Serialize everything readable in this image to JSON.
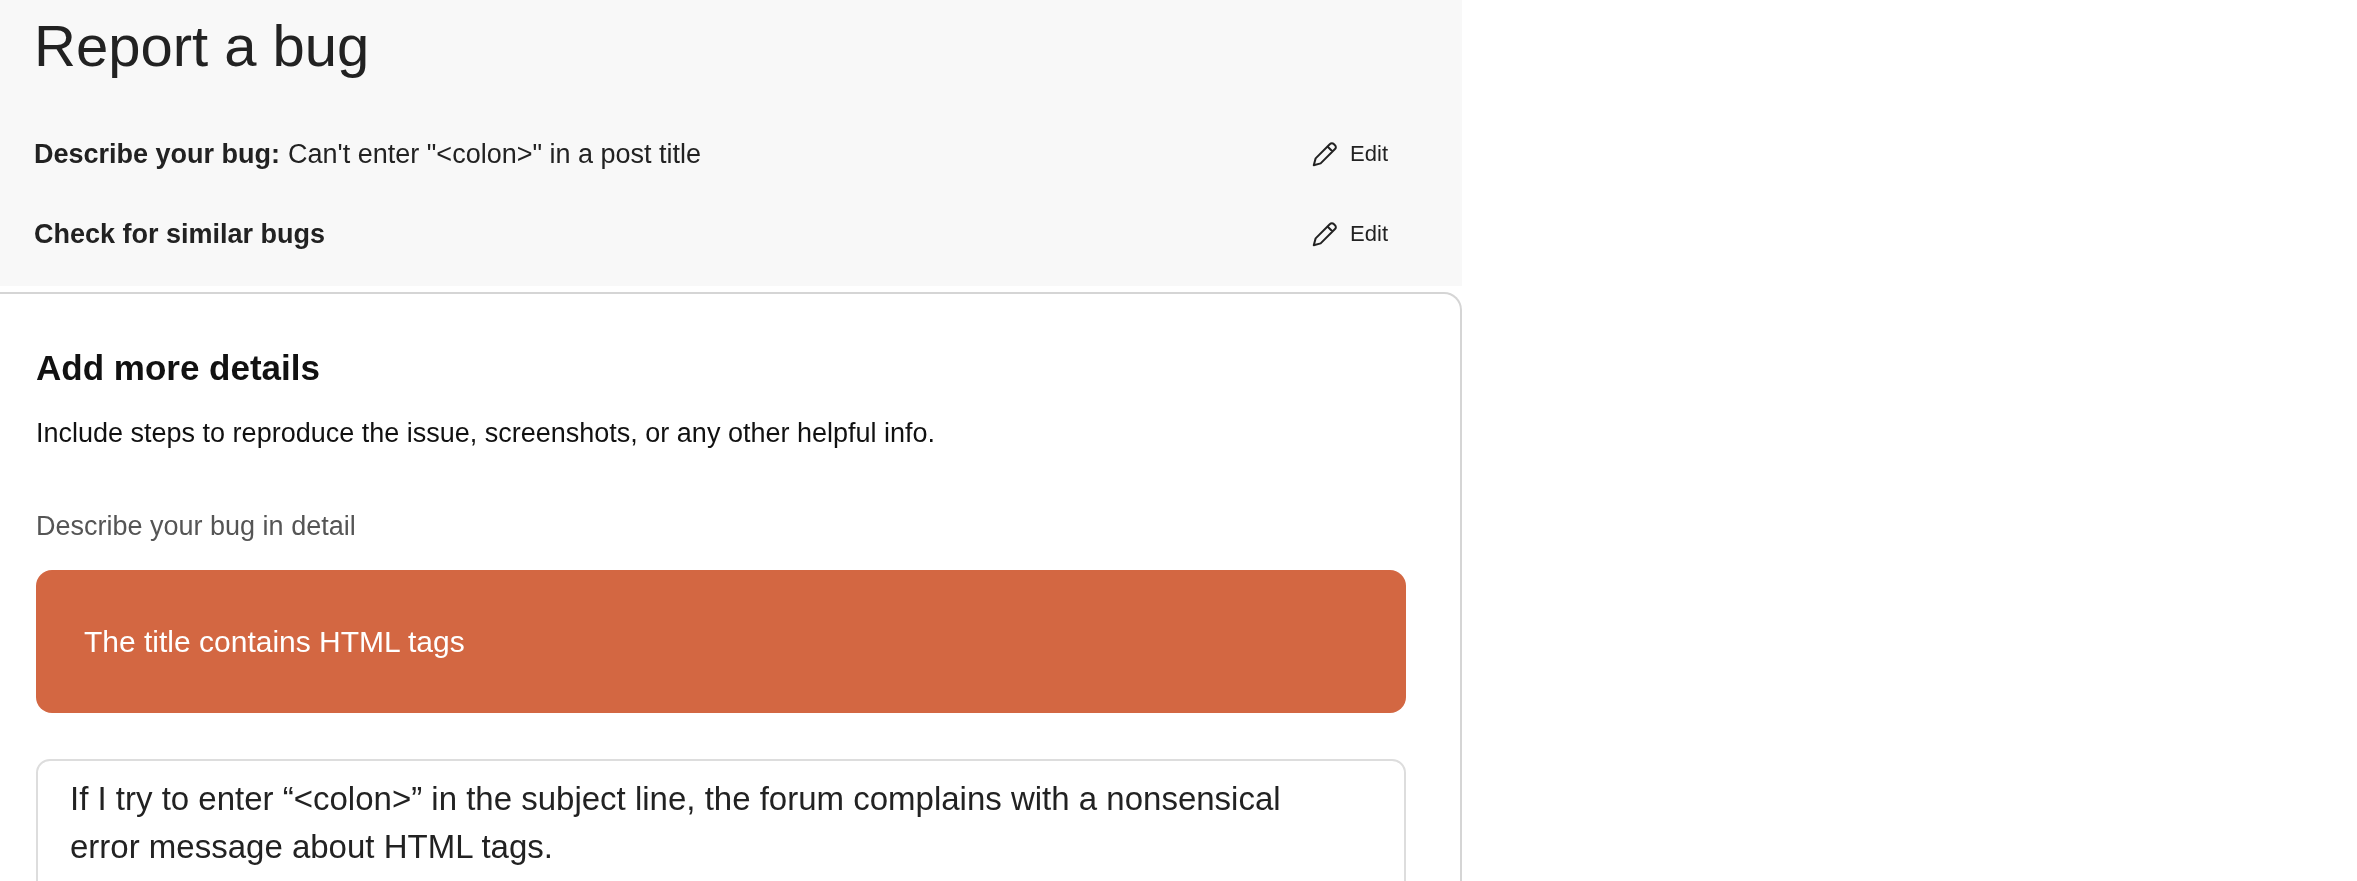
{
  "page": {
    "title": "Report a bug"
  },
  "steps": [
    {
      "label": "Describe your bug:",
      "value": "Can't enter \"<colon>\" in a post title",
      "action": "Edit"
    },
    {
      "label": "Check for similar bugs",
      "action": "Edit"
    }
  ],
  "details": {
    "heading": "Add more details",
    "subtitle": "Include steps to reproduce the issue, screenshots, or any other helpful info.",
    "field_label": "Describe your bug in detail",
    "error": "The title contains HTML tags",
    "value": "If I try to enter “<colon>” in the subject line, the forum complains with a nonsensical error message about HTML tags."
  }
}
